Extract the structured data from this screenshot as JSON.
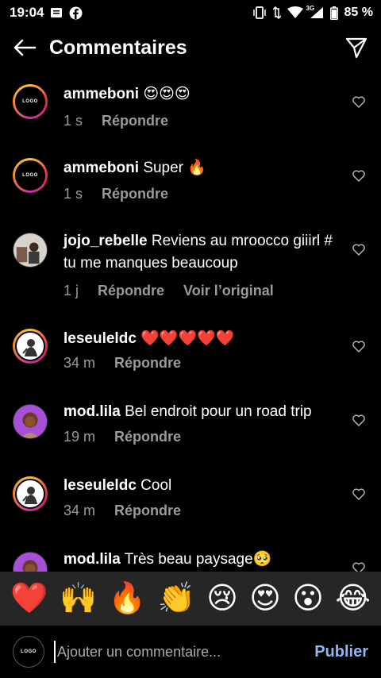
{
  "status_bar": {
    "time": "19:04",
    "network_label": "3G",
    "battery": "85 %",
    "icons": [
      "message-icon",
      "facebook-icon",
      "vibrate-icon",
      "data-arrows-icon",
      "wifi-icon",
      "signal-icon",
      "battery-icon"
    ]
  },
  "header": {
    "title": "Commentaires",
    "back_icon": "arrow-left-icon",
    "share_icon": "paper-plane-icon"
  },
  "comments": [
    {
      "username": "ammeboni",
      "text": "😍😍😍",
      "time": "1 s",
      "reply": "Répondre"
    },
    {
      "username": "ammeboni",
      "text": "Super 🔥",
      "time": "1 s",
      "reply": "Répondre"
    },
    {
      "username": "jojo_rebelle",
      "text": "Reviens au mroocco giiirl # tu me manques beaucoup",
      "time": "1 j",
      "reply": "Répondre",
      "extra": "Voir l’original"
    },
    {
      "username": "leseuleldc",
      "text": "❤️❤️❤️❤️❤️",
      "time": "34 m",
      "reply": "Répondre"
    },
    {
      "username": "mod.lila",
      "text": "Bel endroit pour  un road trip",
      "time": "19 m",
      "reply": "Répondre"
    },
    {
      "username": "leseuleldc",
      "text": "Cool",
      "time": "34 m",
      "reply": "Répondre"
    },
    {
      "username": "mod.lila",
      "text": "Très beau paysage🥺",
      "time": "",
      "reply": ""
    }
  ],
  "quick_emojis": [
    "❤️",
    "🙌",
    "🔥",
    "👏",
    "😢",
    "😍",
    "😮",
    "😂"
  ],
  "composer": {
    "placeholder": "Ajouter un commentaire...",
    "publish_label": "Publier"
  },
  "colors": {
    "background": "#000000",
    "muted_text": "#9a9a9a",
    "publish_blue": "#8eb6f2",
    "emoji_bar": "#262626"
  }
}
